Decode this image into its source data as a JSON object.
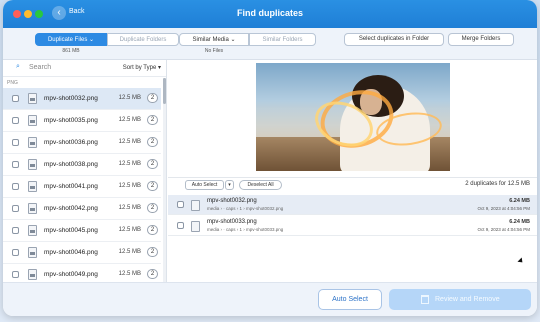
{
  "window": {
    "title": "Find duplicates",
    "back_label": "Back",
    "back_icon": "chevron-left-icon"
  },
  "tabs": {
    "duplicate_files": "Duplicate Files ⌄",
    "duplicate_folders": "Duplicate Folders",
    "similar_media": "Similar Media ⌄",
    "similar_folders": "Similar Folders",
    "duplicate_files_sub": "861 MB",
    "similar_media_sub": "No Files"
  },
  "toolbar": {
    "select_duplicates_label": "Select duplicates in Folder",
    "merge_folders_label": "Merge Folders"
  },
  "sidebar": {
    "search_placeholder": "Search",
    "sort_label": "Sort by Type ▾",
    "group_label": "PNG",
    "items": [
      {
        "name": "mpv-shot0032.png",
        "size": "12.5 MB",
        "count": "2",
        "selected": true
      },
      {
        "name": "mpv-shot0035.png",
        "size": "12.5 MB",
        "count": "2",
        "selected": false
      },
      {
        "name": "mpv-shot0036.png",
        "size": "12.5 MB",
        "count": "2",
        "selected": false
      },
      {
        "name": "mpv-shot0038.png",
        "size": "12.5 MB",
        "count": "2",
        "selected": false
      },
      {
        "name": "mpv-shot0041.png",
        "size": "12.5 MB",
        "count": "2",
        "selected": false
      },
      {
        "name": "mpv-shot0042.png",
        "size": "12.5 MB",
        "count": "2",
        "selected": false
      },
      {
        "name": "mpv-shot0045.png",
        "size": "12.5 MB",
        "count": "2",
        "selected": false
      },
      {
        "name": "mpv-shot0046.png",
        "size": "12.5 MB",
        "count": "2",
        "selected": false
      },
      {
        "name": "mpv-shot0049.png",
        "size": "12.5 MB",
        "count": "2",
        "selected": false
      }
    ]
  },
  "actions": {
    "auto_select_label": "Auto Select",
    "auto_select_arrow": "▾",
    "deselect_all_label": "Deselect All",
    "summary": "2 duplicates for 12.5 MB"
  },
  "duplicates": [
    {
      "name": "mpv-shot0032.png",
      "path": "media › · caps › 1 › mpv-shot0032.png",
      "size": "6.24 MB",
      "date": "Oct 9, 2023 at 4:04:56 PM"
    },
    {
      "name": "mpv-shot0033.png",
      "path": "media › · caps › 1 › mpv-shot0033.png",
      "size": "6.24 MB",
      "date": "Oct 9, 2023 at 4:04:56 PM"
    }
  ],
  "footer": {
    "auto_select_label": "Auto Select",
    "review_label": "Review and Remove"
  },
  "colors": {
    "accent": "#2d8ae3",
    "titlebar": "#1f7fd6",
    "selection": "#dde8f5",
    "disabled_button": "#b5d6f8"
  }
}
